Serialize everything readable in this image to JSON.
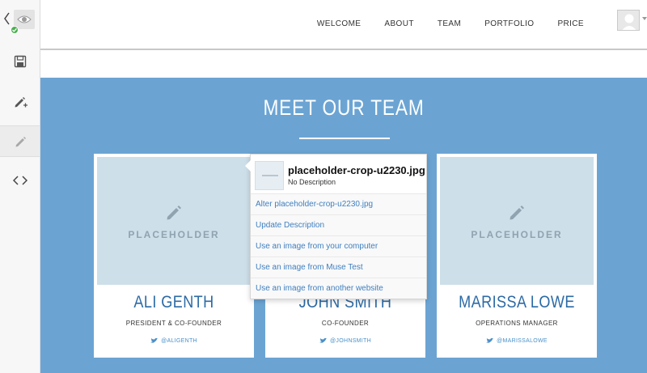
{
  "toolbar": {
    "icons": [
      "back-chevron-icon",
      "preview-eye-icon",
      "check-badge-icon",
      "save-icon",
      "add-edit-icon",
      "edit-pencil-icon",
      "code-icon"
    ]
  },
  "nav": {
    "links": [
      "WELCOME",
      "ABOUT",
      "TEAM",
      "PORTFOLIO",
      "PRICE"
    ]
  },
  "team": {
    "title": "MEET OUR TEAM",
    "placeholder_label": "PLACEHOLDER",
    "members": [
      {
        "name": "ALI GENTH",
        "role": "PRESIDENT & CO-FOUNDER",
        "twitter": "@ALIGENTH"
      },
      {
        "name": "JOHN SMITH",
        "role": "CO-FOUNDER",
        "twitter": "@JOHNSMITH"
      },
      {
        "name": "MARISSA LOWE",
        "role": "OPERATIONS MANAGER",
        "twitter": "@MARISSALOWE"
      }
    ]
  },
  "popover": {
    "filename": "placeholder-crop-u2230.jpg",
    "description": "No Description",
    "actions": [
      "Alter placeholder-crop-u2230.jpg",
      "Update Description",
      " Use an image from your computer",
      "Use an image from Muse Test",
      "Use an image from another website"
    ]
  },
  "colors": {
    "section_bg": "#6ba4d3",
    "accent_blue": "#2c6aa5",
    "link_blue": "#3f7fc0",
    "placeholder_bg": "#cddfe9",
    "status_green": "#4caf50"
  }
}
